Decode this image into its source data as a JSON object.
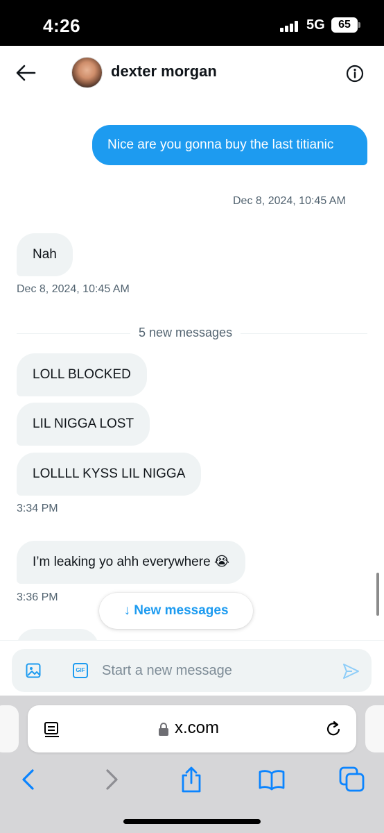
{
  "status_bar": {
    "time": "4:26",
    "network": "5G",
    "battery": "65"
  },
  "header": {
    "contact_name": "dexter morgan"
  },
  "messages": {
    "sent_1": {
      "text": "Nice are you gonna buy the last titianic",
      "timestamp": "Dec 8, 2024, 10:45 AM"
    },
    "received_1": {
      "text": "Nah",
      "timestamp": "Dec 8, 2024, 10:45 AM"
    },
    "divider": "5 new messages",
    "received_2": "LOLL BLOCKED",
    "received_3": "LIL NIGGA LOST",
    "received_4": "LOLLLL KYSS LIL NIGGA",
    "timestamp_group_2": "3:34 PM",
    "received_5": "I’m leaking yo ahh everywhere 😭",
    "timestamp_group_3": "3:36 PM"
  },
  "new_messages_button": "↓ New messages",
  "composer": {
    "placeholder": "Start a new message",
    "gif_label": "GIF"
  },
  "browser": {
    "url": "x.com"
  },
  "colors": {
    "accent": "#1d9bf0",
    "incoming_bubble": "#eff3f4",
    "secondary_text": "#536471"
  },
  "icons": [
    "back-arrow-icon",
    "info-icon",
    "image-icon",
    "gif-icon",
    "send-icon",
    "reader-icon",
    "lock-icon",
    "reload-icon",
    "back-chevron-icon",
    "forward-chevron-icon",
    "share-icon",
    "bookmarks-icon",
    "tabs-icon"
  ]
}
